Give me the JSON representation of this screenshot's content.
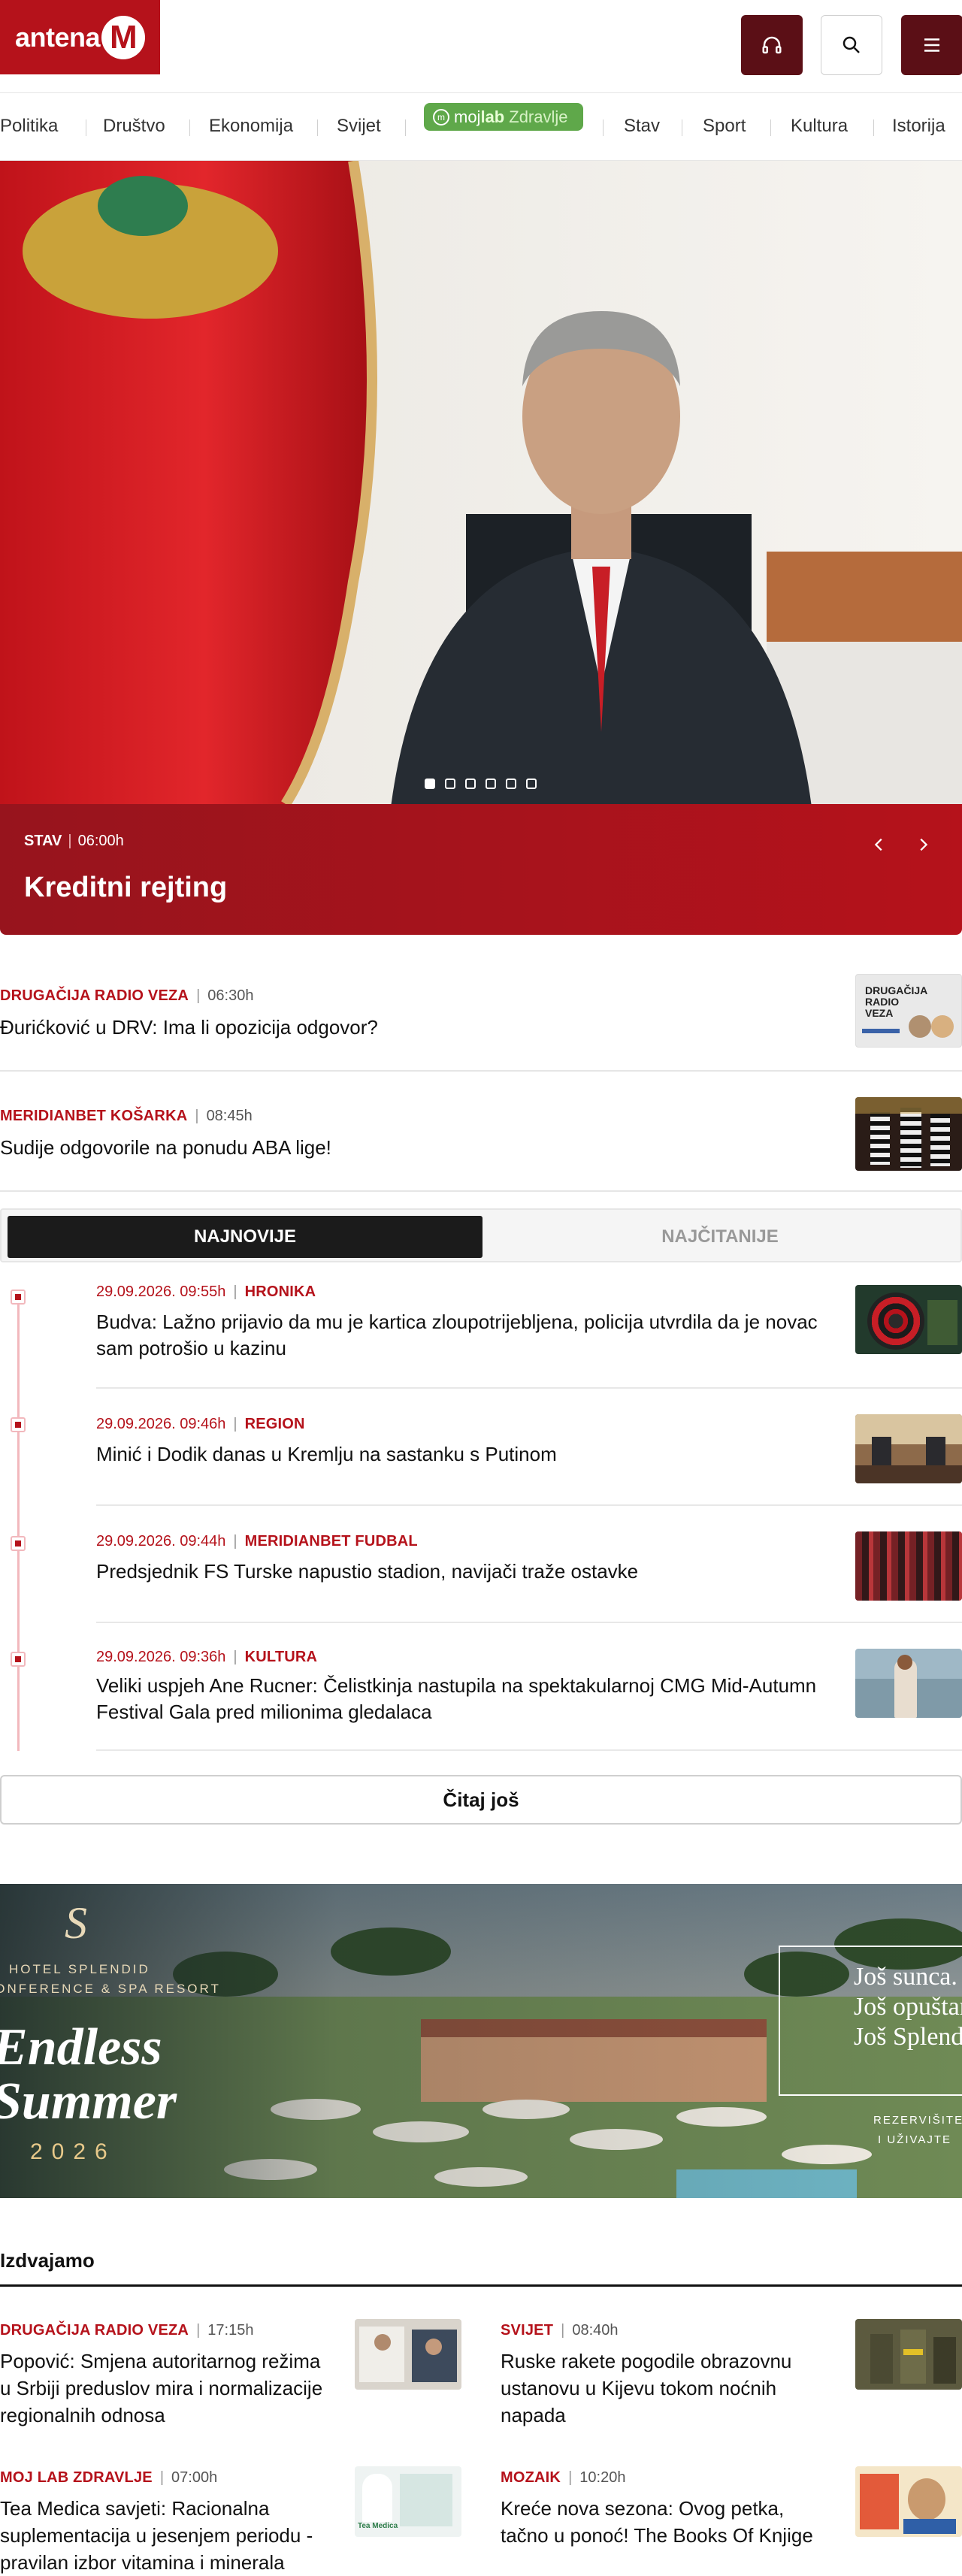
{
  "header": {
    "logo_text": "antena",
    "logo_letter": "M",
    "audio_icon": "headphones-icon",
    "search_icon": "search-icon",
    "menu_icon": "hamburger-menu-icon"
  },
  "nav": {
    "items": [
      "Politika",
      "Društvo",
      "Ekonomija",
      "Svijet",
      "Stav",
      "Sport",
      "Kultura",
      "Istorija"
    ],
    "pill": {
      "brand": "moj",
      "brand_bold": "lab",
      "label": "Zdravlje"
    }
  },
  "hero": {
    "category": "STAV",
    "time": "06:00h",
    "title": "Kreditni rejting",
    "slide_count": 6,
    "active_slide": 1
  },
  "top_stories": [
    {
      "category": "DRUGAČIJA RADIO VEZA",
      "time": "06:30h",
      "title": "Đurićković u DRV: Ima li opozicija odgovor?",
      "thumb_text": "DRUGAČIJA RADIO VEZA"
    },
    {
      "category": "MERIDIANBET KOŠARKA",
      "time": "08:45h",
      "title": "Sudije odgovorile na ponudu ABA lige!"
    }
  ],
  "tabs": {
    "active": "NAJNOVIJE",
    "inactive": "NAJČITANIJE"
  },
  "timeline": [
    {
      "date": "29.09.2026. 09:55h",
      "category": "HRONIKA",
      "title": "Budva: Lažno prijavio da mu je kartica zloupotrijebljena, policija utvrdila da je novac sam potrošio u kazinu"
    },
    {
      "date": "29.09.2026. 09:46h",
      "category": "REGION",
      "title": "Minić i Dodik danas u Kremlju na sastanku s Putinom"
    },
    {
      "date": "29.09.2026. 09:44h",
      "category": "MERIDIANBET FUDBAL",
      "title": "Predsjednik FS Turske napustio stadion, navijači traže ostavke"
    },
    {
      "date": "29.09.2026. 09:36h",
      "category": "KULTURA",
      "title": "Veliki uspjeh Ane Rucner: Čelistkinja nastupila na spektakularnoj CMG Mid-Autumn Festival Gala pred milionima gledalaca"
    }
  ],
  "more_button": "Čitaj još",
  "ad": {
    "logo_letter": "S",
    "hotel_line1": "HOTEL SPLENDID",
    "hotel_line2": "CONFERENCE & SPA RESORT",
    "headline1": "Endless",
    "headline2": "Summer",
    "year": "2026",
    "right_lines": [
      "Još sunca.",
      "Još opuštanja.",
      "Još Splendida."
    ],
    "cta1": "REZERVIŠITE",
    "cta2": "I UŽIVAJTE"
  },
  "featured": {
    "title": "Izdvajamo",
    "items": [
      {
        "category": "DRUGAČIJA RADIO VEZA",
        "time": "17:15h",
        "title": "Popović: Smjena autoritarnog režima u Srbiji preduslov mira i normalizacije regionalnih odnosa"
      },
      {
        "category": "SVIJET",
        "time": "08:40h",
        "title": "Ruske rakete pogodile obrazovnu ustanovu u Kijevu tokom noćnih napada"
      },
      {
        "category": "MOJ LAB ZDRAVLJE",
        "time": "07:00h",
        "title": "Tea Medica savjeti: Racionalna suplementacija u jesenjem periodu - pravilan izbor vitamina i minerala",
        "thumb_text": "Tea Medica"
      },
      {
        "category": "MOZAIK",
        "time": "10:20h",
        "title": "Kreće nova sezona: Ovog petka, tačno u ponoć! The Books Of Knjige"
      }
    ]
  },
  "colors": {
    "brand_red": "#b5121b",
    "dark_red": "#5b0f16",
    "green": "#5fa84a"
  }
}
